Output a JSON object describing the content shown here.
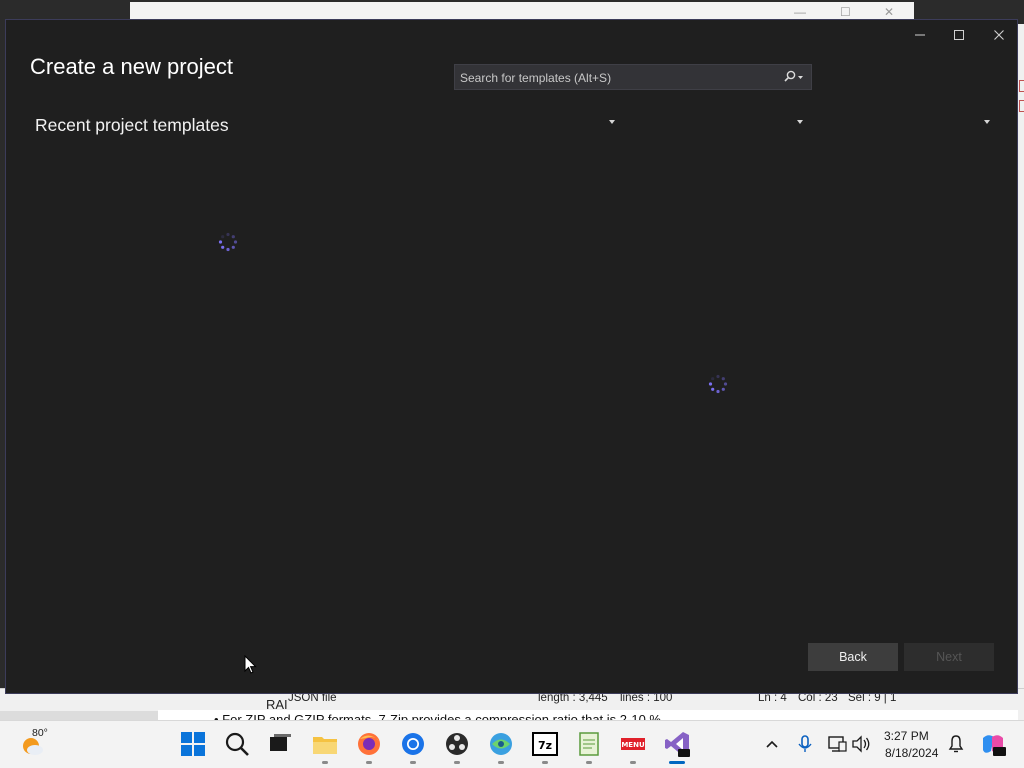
{
  "dialog": {
    "title": "Create a new project",
    "search_placeholder": "Search for templates (Alt+S)",
    "recent_title": "Recent project templates",
    "back_label": "Back",
    "next_label": "Next",
    "window_controls": [
      "minimize-icon",
      "maximize-icon",
      "close-icon"
    ]
  },
  "background_editor": {
    "status": {
      "side_label": "RAI",
      "file_type": "JSON file",
      "length": "length : 3,445",
      "lines": "lines : 100",
      "ln": "Ln : 4",
      "col": "Col : 23",
      "sel": "Sel : 9 | 1"
    },
    "doc_line": "• For ZIP and GZIP formats, 7-Zip provides a compression ratio that is 2-10 %"
  },
  "taskbar": {
    "weather_temp": "80°",
    "time": "3:27 PM",
    "date": "8/18/2024",
    "apps": [
      "start-icon",
      "search-icon",
      "task-view-icon",
      "file-explorer-icon",
      "firefox-icon",
      "chrome-icon",
      "obs-icon",
      "network-app-icon",
      "7zip-icon",
      "notepad-plus-icon",
      "menu-app-icon",
      "visual-studio-preview-icon"
    ],
    "tray": [
      "chevron-up-icon",
      "microphone-icon",
      "network-icon",
      "volume-icon",
      "notification-bell-icon",
      "copilot-icon"
    ]
  },
  "colors": {
    "dialog_bg": "#1f1f1f",
    "accent": "#0067c0",
    "spinner": "#7a6ff0"
  }
}
